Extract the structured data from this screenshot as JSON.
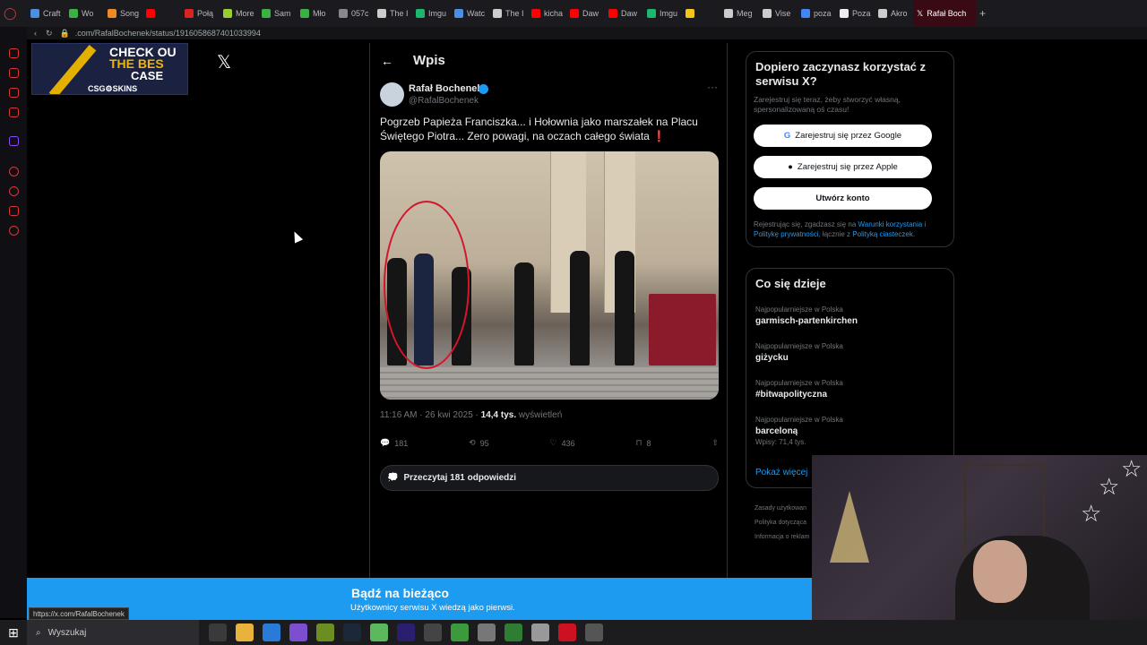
{
  "browser": {
    "tabs": [
      {
        "label": "Craft",
        "color": "#4a90e2"
      },
      {
        "label": "Wo",
        "color": "#3cb043"
      },
      {
        "label": "Song",
        "color": "#f08a24"
      },
      {
        "label": "",
        "color": "#ff0000"
      },
      {
        "label": "Połą",
        "color": "#dd2222"
      },
      {
        "label": "More",
        "color": "#9acd32"
      },
      {
        "label": "Sam",
        "color": "#3cb043"
      },
      {
        "label": "Mło",
        "color": "#3cb043"
      },
      {
        "label": "057c",
        "color": "#888888"
      },
      {
        "label": "The I",
        "color": "#cccccc"
      },
      {
        "label": "Imgu",
        "color": "#1bb76e"
      },
      {
        "label": "Watc",
        "color": "#4a90e2"
      },
      {
        "label": "The I",
        "color": "#cccccc"
      },
      {
        "label": "kicha",
        "color": "#ff0000"
      },
      {
        "label": "Daw",
        "color": "#ff0000"
      },
      {
        "label": "Daw",
        "color": "#ff0000"
      },
      {
        "label": "Imgu",
        "color": "#1bb76e"
      },
      {
        "label": "",
        "color": "#f5c518"
      },
      {
        "label": "Meg",
        "color": "#cccccc"
      },
      {
        "label": "Vise",
        "color": "#cccccc"
      },
      {
        "label": "poza",
        "color": "#4285f4"
      },
      {
        "label": "Poza",
        "color": "#eeeeee"
      },
      {
        "label": "Akro",
        "color": "#cccccc"
      }
    ],
    "active_tab": "Rafał Boch",
    "url": ".com/RafalBochenek/status/1916058687401033994"
  },
  "ad": {
    "line1": "CHECK OU",
    "line2": "THE BES",
    "line3": "CASE",
    "brand": "CSG⚙SKINS"
  },
  "x_logo": "𝕏",
  "post_header": {
    "back": "←",
    "title": "Wpis"
  },
  "tweet": {
    "author": "Rafał Bochenek",
    "handle": "@RafalBochenek",
    "more": "···",
    "text": "Pogrzeb Papieża Franciszka... i Hołownia jako marszałek na Placu Świętego Piotra... Zero powagi, na oczach całego świata ❗",
    "time": "11:16 AM · 26 kwi 2025 · ",
    "views": "14,4 tys.",
    "views_label": " wyświetleń",
    "replies": "181",
    "reposts": "95",
    "likes": "436",
    "bookmarks": "8",
    "read_replies": "Przeczytaj 181 odpowiedzi"
  },
  "signup": {
    "title": "Dopiero zaczynasz korzystać z serwisu X?",
    "subtitle": "Zarejestruj się teraz, żeby stworzyć własną, spersonalizowaną oś czasu!",
    "google": "Zarejestruj się przez Google",
    "apple": "Zarejestruj się przez Apple",
    "create": "Utwórz konto",
    "legal_1": "Rejestrując się, zgadzasz się na ",
    "legal_terms": "Warunki korzystania",
    "legal_2": " i ",
    "legal_privacy": "Politykę prywatności",
    "legal_3": ", łącznie z ",
    "legal_cookies": "Polityką ciasteczek",
    "legal_4": "."
  },
  "trends": {
    "title": "Co się dzieje",
    "items": [
      {
        "context": "Najpopularniejsze w Polska",
        "name": "garmisch-partenkirchen",
        "posts": ""
      },
      {
        "context": "Najpopularniejsze w Polska",
        "name": "giżycku",
        "posts": ""
      },
      {
        "context": "Najpopularniejsze w Polska",
        "name": "#bitwapolityczna",
        "posts": ""
      },
      {
        "context": "Najpopularniejsze w Polska",
        "name": "barceloną",
        "posts": "Wpisy: 71,4 tys."
      }
    ],
    "show_more": "Pokaż więcej"
  },
  "footer": [
    "Zasady użytkowan",
    "Polityka dotycząca",
    "Informacja o reklam"
  ],
  "banner": {
    "title": "Bądź na bieżąco",
    "subtitle": "Użytkownicy serwisu X wiedzą jako pierwsi."
  },
  "status_url": "https://x.com/RafalBochenek",
  "taskbar": {
    "search_placeholder": "Wyszukaj",
    "icons": [
      {
        "name": "task-view-icon",
        "color": "#3a3a3a"
      },
      {
        "name": "file-explorer-icon",
        "color": "#e8b33a"
      },
      {
        "name": "vscode-icon",
        "color": "#2a7ad8"
      },
      {
        "name": "obsidian-icon",
        "color": "#7b4fd0"
      },
      {
        "name": "app-icon-1",
        "color": "#6b8e23"
      },
      {
        "name": "steam-icon",
        "color": "#1b2838"
      },
      {
        "name": "notepad-icon",
        "color": "#5cb85c"
      },
      {
        "name": "premiere-icon",
        "color": "#2a1f6e"
      },
      {
        "name": "obs-icon",
        "color": "#444444"
      },
      {
        "name": "game-icon-1",
        "color": "#3c9a3c"
      },
      {
        "name": "app-icon-2",
        "color": "#777777"
      },
      {
        "name": "app-icon-3",
        "color": "#2e7d32"
      },
      {
        "name": "app-icon-4",
        "color": "#999999"
      },
      {
        "name": "opera-icon",
        "color": "#cc1122"
      },
      {
        "name": "app-icon-5",
        "color": "#555555"
      }
    ]
  }
}
